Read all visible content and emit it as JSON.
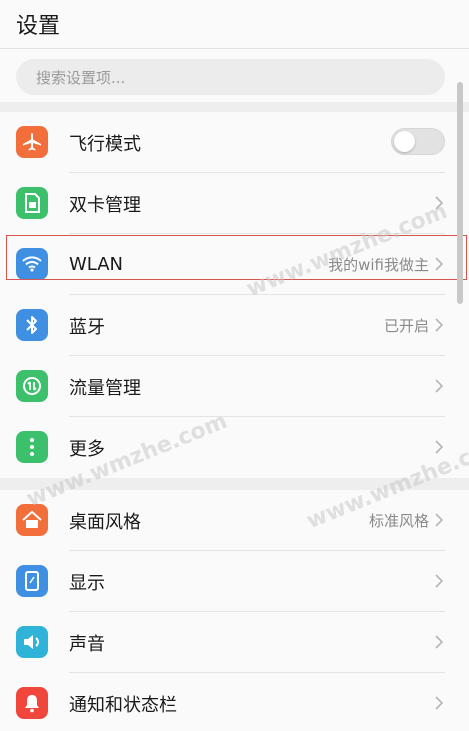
{
  "header": {
    "title": "设置"
  },
  "search": {
    "placeholder": "搜索设置项..."
  },
  "group1": [
    {
      "label": "飞行模式",
      "type": "toggle",
      "on": false,
      "color": "#f26f3b",
      "icon": "airplane-icon"
    },
    {
      "label": "双卡管理",
      "type": "nav",
      "value": "",
      "color": "#3cc06b",
      "icon": "sim-card-icon"
    },
    {
      "label": "WLAN",
      "type": "nav",
      "value": "我的wifi我做主",
      "color": "#3f8fe3",
      "icon": "wifi-icon"
    },
    {
      "label": "蓝牙",
      "type": "nav",
      "value": "已开启",
      "color": "#3f8fe3",
      "icon": "bluetooth-icon"
    },
    {
      "label": "流量管理",
      "type": "nav",
      "value": "",
      "color": "#3cc06b",
      "icon": "data-usage-icon"
    },
    {
      "label": "更多",
      "type": "nav",
      "value": "",
      "color": "#3cc06b",
      "icon": "more-icon"
    }
  ],
  "group2": [
    {
      "label": "桌面风格",
      "type": "nav",
      "value": "标准风格",
      "color": "#f26f3b",
      "icon": "home-icon"
    },
    {
      "label": "显示",
      "type": "nav",
      "value": "",
      "color": "#3f8fe3",
      "icon": "display-icon"
    },
    {
      "label": "声音",
      "type": "nav",
      "value": "",
      "color": "#2fb3d8",
      "icon": "speaker-icon"
    },
    {
      "label": "通知和状态栏",
      "type": "nav",
      "value": "",
      "color": "#f0463c",
      "icon": "bell-icon"
    }
  ],
  "watermark": "www.wmzhe.com"
}
